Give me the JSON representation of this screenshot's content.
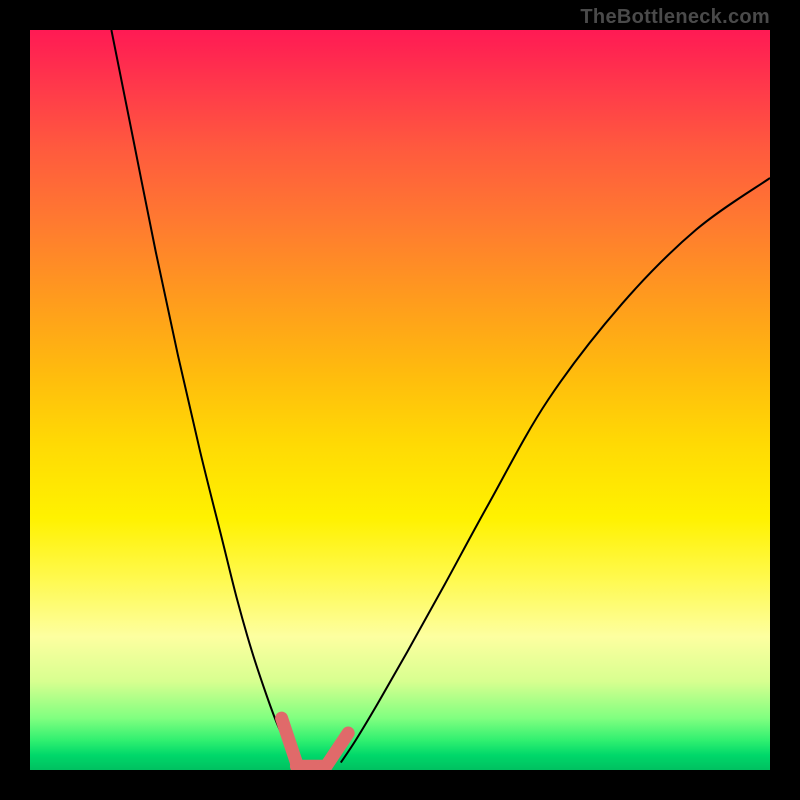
{
  "watermark": "TheBottleneck.com",
  "chart_data": {
    "type": "line",
    "title": "",
    "xlabel": "",
    "ylabel": "",
    "xlim": [
      0,
      100
    ],
    "ylim": [
      0,
      100
    ],
    "series": [
      {
        "name": "left-curve",
        "x": [
          11,
          14,
          17,
          20,
          23,
          26,
          28,
          30,
          32,
          33.5,
          35,
          36
        ],
        "y": [
          100,
          85,
          70,
          56,
          43,
          31,
          23,
          16,
          10,
          6,
          3,
          1
        ]
      },
      {
        "name": "right-curve",
        "x": [
          42,
          44,
          47,
          51,
          56,
          62,
          70,
          80,
          90,
          100
        ],
        "y": [
          1,
          4,
          9,
          16,
          25,
          36,
          50,
          63,
          73,
          80
        ]
      },
      {
        "name": "marker-left",
        "x": [
          34,
          36
        ],
        "y": [
          7,
          1
        ]
      },
      {
        "name": "marker-bottom",
        "x": [
          36,
          40
        ],
        "y": [
          0.5,
          0.5
        ]
      },
      {
        "name": "marker-right",
        "x": [
          40,
          43
        ],
        "y": [
          0.5,
          5
        ]
      }
    ]
  }
}
